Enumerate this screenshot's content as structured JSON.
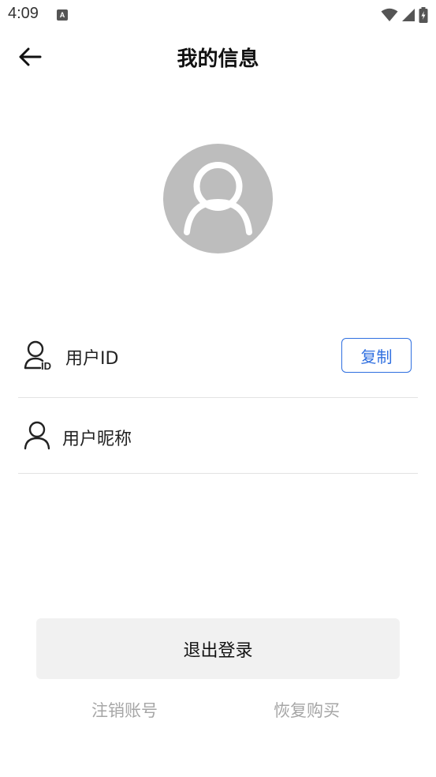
{
  "status_bar": {
    "time": "4:09",
    "app_icon_letter": "A"
  },
  "header": {
    "title": "我的信息",
    "back_icon": "arrow-left-icon"
  },
  "profile": {
    "avatar_icon": "user-placeholder-icon",
    "rows": [
      {
        "icon": "user-id-icon",
        "label": "用户ID",
        "action_label": "复制"
      },
      {
        "icon": "user-icon",
        "label": "用户昵称"
      }
    ]
  },
  "actions": {
    "logout_label": "退出登录",
    "cancel_account_label": "注销账号",
    "restore_purchase_label": "恢复购买"
  },
  "colors": {
    "accent": "#2f6fe0",
    "avatar_bg": "#bdbdbd",
    "button_bg": "#f1f1f1",
    "muted_text": "#a6a6a6"
  }
}
